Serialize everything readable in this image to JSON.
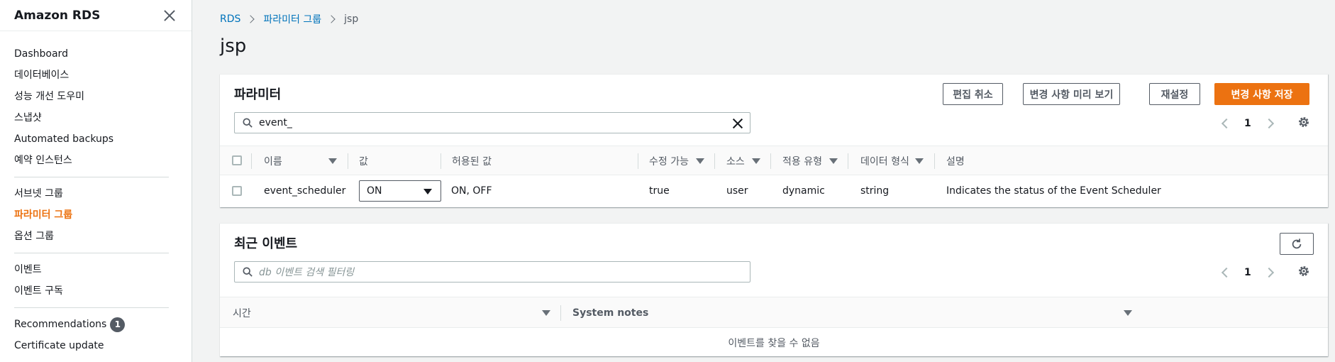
{
  "sidebar": {
    "title": "Amazon RDS",
    "group1": [
      "Dashboard",
      "데이터베이스",
      "성능 개선 도우미",
      "스냅샷",
      "Automated backups",
      "예약 인스턴스"
    ],
    "group2": [
      "서브넷 그룹",
      "파라미터 그룹",
      "옵션 그룹"
    ],
    "group3": [
      "이벤트",
      "이벤트 구독"
    ],
    "group4": {
      "recommendations": "Recommendations",
      "recommendations_count": "1",
      "certificate": "Certificate update"
    }
  },
  "breadcrumb": {
    "root": "RDS",
    "parent": "파라미터 그룹",
    "current": "jsp"
  },
  "page_title": "jsp",
  "params_panel": {
    "title": "파라미터",
    "buttons": {
      "cancel": "편집 취소",
      "preview": "변경 사항 미리 보기",
      "reset": "재설정",
      "save": "변경 사항 저장"
    },
    "search_value": "event_",
    "page": "1",
    "columns": {
      "name": "이름",
      "value": "값",
      "allowed": "허용된 값",
      "modifiable": "수정 가능",
      "source": "소스",
      "apply_type": "적용 유형",
      "data_type": "데이터 형식",
      "description": "설명"
    },
    "rows": [
      {
        "name": "event_scheduler",
        "value": "ON",
        "allowed": "ON, OFF",
        "modifiable": "true",
        "source": "user",
        "apply_type": "dynamic",
        "data_type": "string",
        "description": "Indicates the status of the Event Scheduler"
      }
    ]
  },
  "events_panel": {
    "title": "최근 이벤트",
    "search_placeholder": "db 이벤트 검색 필터링",
    "page": "1",
    "columns": {
      "time": "시간",
      "notes": "System notes"
    },
    "empty": "이벤트를 찾을 수 없음"
  },
  "colors": {
    "accent": "#ec7211",
    "link": "#0073bb"
  }
}
